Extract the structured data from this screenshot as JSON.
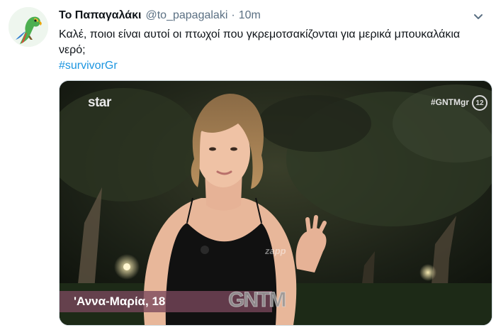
{
  "tweet": {
    "display_name": "Το Παπαγαλάκι",
    "handle": "@to_papagalaki",
    "separator": "·",
    "time": "10m",
    "text": "Καλέ, ποιοι είναι αυτοί οι πτωχοί που γκρεμοτσακίζονται για μερικά μπουκαλάκια νερό;",
    "hashtag": "#survivorGr",
    "avatar_icon": "parrot-icon",
    "menu_icon": "chevron-down-icon",
    "link_color": "#1b95e0"
  },
  "media": {
    "channel_logo": "star",
    "show_tag": "#GNTMgr",
    "rating": "12",
    "watermark": "zapp",
    "caption": "'Αννα-Μαρία, 18",
    "show_logo": "GNTM"
  }
}
